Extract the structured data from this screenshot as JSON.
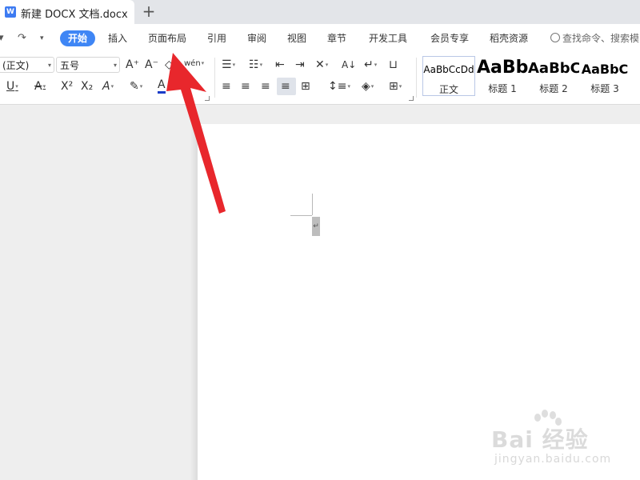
{
  "tabbar": {
    "doc_logo": "W",
    "doc_title": "新建 DOCX 文档.docx",
    "new_tab": "+"
  },
  "menubar": {
    "quick_access": {
      "redo_glyph": "↷",
      "more_glyph": "▾"
    },
    "items": [
      "开始",
      "插入",
      "页面布局",
      "引用",
      "审阅",
      "视图",
      "章节",
      "开发工具",
      "会员专享",
      "稻壳资源"
    ],
    "active_item": "开始",
    "search_placeholder": "查找命令、搜索模"
  },
  "ribbon": {
    "font_name": "(正文)",
    "font_size": "五号",
    "grow_font": "A⁺",
    "shrink_font": "A⁻",
    "clear_format": "◇",
    "phonetic_guide": "wén",
    "underline": "U",
    "strikethrough": "A",
    "superscript": "X²",
    "subscript": "X₂",
    "text_effect": "A",
    "highlight": "✎",
    "font_color": "A",
    "bullets": "☰",
    "numbering": "☷",
    "decrease_indent": "⇤",
    "increase_indent": "⇥",
    "chinese_layout": "✕",
    "sort": "A↓",
    "show_marks": "↵",
    "ruler": "⊔",
    "align_left": "≡",
    "align_center": "≡",
    "align_right": "≡",
    "justify": "≡",
    "distributed": "⊞",
    "line_spacing": "↕≡",
    "shading": "◈",
    "borders": "⊞",
    "dropdown_glyph": "▾",
    "styles": [
      {
        "sample": "AaBbCcDd",
        "label": "正文"
      },
      {
        "sample": "AaBb",
        "label": "标题 1"
      },
      {
        "sample": "AaBbC",
        "label": "标题 2"
      },
      {
        "sample": "AaBbC",
        "label": "标题 3"
      }
    ]
  },
  "document": {
    "paragraph_mark": "↵"
  },
  "watermark": {
    "main": "Bai 经验",
    "sub": "jingyan.baidu.com"
  },
  "colors": {
    "accent": "#3f86f5",
    "annotation_arrow": "#e8272c",
    "font_color_underline": "#1a3cc8"
  }
}
